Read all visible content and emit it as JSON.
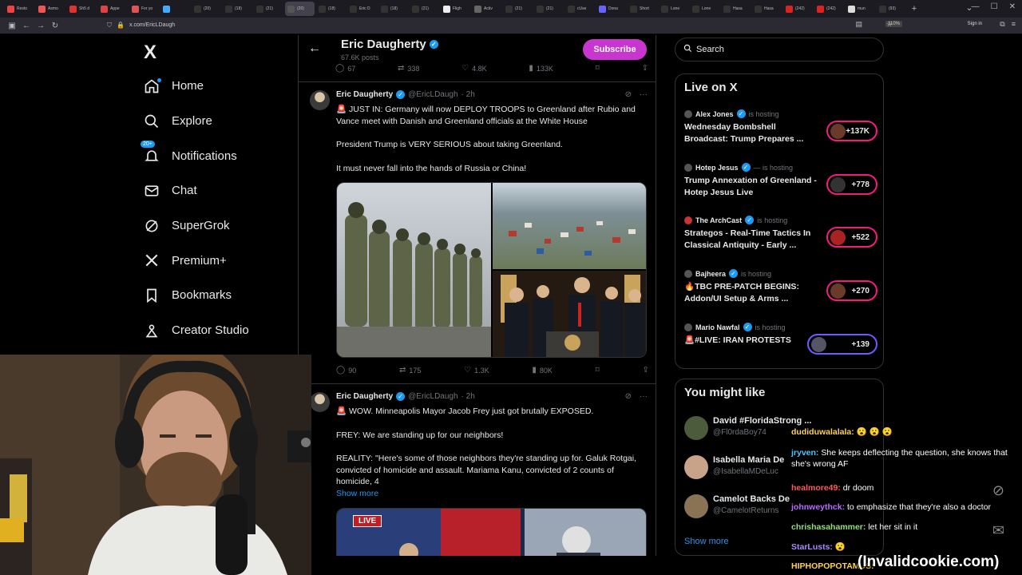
{
  "browser": {
    "tabs": [
      "Resto",
      "Asmo",
      "Sh5 d",
      "Appe",
      "For yo",
      "",
      "(20)",
      "(18)",
      "(21)",
      "(20)",
      "(18)",
      "Eric D",
      "(18)",
      "(21)",
      "Fligh",
      "Activ",
      "(21)",
      "(21)",
      "cUse",
      "Dona",
      "Short",
      "Lone",
      "Lone",
      "Hasa",
      "Hasa",
      "(242)",
      "(242)",
      "mun",
      "(93)"
    ],
    "active_tab_index": 9,
    "url": "x.com/EricLDaugh",
    "zoom": "110%",
    "signin": "Sign in",
    "new_tab": "+"
  },
  "sidebar": {
    "logo": "X",
    "items": [
      {
        "label": "Home",
        "icon": "home-icon"
      },
      {
        "label": "Explore",
        "icon": "search-icon"
      },
      {
        "label": "Notifications",
        "icon": "bell-icon",
        "badge": "20+"
      },
      {
        "label": "Chat",
        "icon": "mail-icon"
      },
      {
        "label": "SuperGrok",
        "icon": "grok-icon"
      },
      {
        "label": "Premium+",
        "icon": "x-premium-icon"
      },
      {
        "label": "Bookmarks",
        "icon": "bookmark-icon"
      },
      {
        "label": "Creator Studio",
        "icon": "creator-icon"
      }
    ]
  },
  "profile_header": {
    "name": "Eric Daugherty",
    "posts": "67.6K posts",
    "subscribe": "Subscribe",
    "prev_stats": {
      "replies": "67",
      "reposts": "338",
      "likes": "4.8K",
      "views": "133K"
    }
  },
  "tweets": [
    {
      "name": "Eric Daugherty",
      "handle": "@EricLDaugh",
      "time": "· 2h",
      "paragraphs": [
        "🚨 JUST IN: Germany will now DEPLOY TROOPS to Greenland after Rubio and Vance meet with Danish and Greenland officials at the White House",
        "President Trump is VERY SERIOUS about taking Greenland.",
        "It must never fall into the hands of Russia or China!"
      ],
      "stats": {
        "replies": "90",
        "reposts": "175",
        "likes": "1.3K",
        "views": "80K"
      }
    },
    {
      "name": "Eric Daugherty",
      "handle": "@EricLDaugh",
      "time": "· 2h",
      "paragraphs": [
        "🚨 WOW. Minneapolis Mayor Jacob Frey just got brutally EXPOSED.",
        "FREY: We are standing up for our neighbors!",
        "REALITY: \"Here's some of those neighbors they're standing up for. Galuk Rotgai, convicted of homicide and assault. Mariama Kanu, convicted of 2 counts of homicide, 4"
      ],
      "show_more": "Show more",
      "media_label": "LIVE"
    }
  ],
  "search": {
    "placeholder": "Search"
  },
  "live": {
    "title": "Live on X",
    "items": [
      {
        "host": "Alex Jones",
        "status": "is hosting",
        "title": "Wednesday Bombshell Broadcast: Trump Prepares ...",
        "count": "+137K"
      },
      {
        "host": "Hotep Jesus",
        "status": "— is hosting",
        "title": "Trump Annexation of Greenland - Hotep Jesus Live",
        "count": "+778"
      },
      {
        "host": "The ArchCast",
        "status": "is hosting",
        "title": "Strategos - Real-Time Tactics In Classical Antiquity - Early ...",
        "count": "+522"
      },
      {
        "host": "Bajheera",
        "status": "is hosting",
        "title": "🔥TBC PRE-PATCH BEGINS: Addon/UI Setup & Arms ...",
        "count": "+270"
      },
      {
        "host": "Mario Nawfal",
        "status": "is hosting",
        "title": "🚨#LIVE: IRAN PROTESTS",
        "count": "+139"
      }
    ]
  },
  "you_might_like": {
    "title": "You might like",
    "items": [
      {
        "name": "David #FloridaStrong ...",
        "handle": "@Fl0rdaBoy74"
      },
      {
        "name": "Isabella Maria De",
        "handle": "@IsabellaMDeLuc"
      },
      {
        "name": "Camelot Backs De",
        "handle": "@CamelotReturns"
      }
    ],
    "show_more": "Show more"
  },
  "chat": {
    "lines": [
      {
        "user": "dudiduwalalala:",
        "msg": "",
        "color": "#ffd24a"
      },
      {
        "user": "jryven:",
        "msg": "She keeps deflecting the question, she knows that she's wrong AF",
        "color": "#4ec4ff"
      },
      {
        "user": "healmore49:",
        "msg": "dr doom",
        "color": "#ff5a5a"
      },
      {
        "user": "johnweythck:",
        "msg": "to emphasize that they're also a doctor",
        "color": "#b86bff"
      },
      {
        "user": "chrishasahammer:",
        "msg": "let her sit in it",
        "color": "#8fe07a"
      },
      {
        "user": "StarLusts:",
        "msg": "",
        "color": "#a78bff"
      },
      {
        "user": "HIPHOPOPOTAMUS:",
        "msg": "",
        "color": "#ffd24a"
      }
    ],
    "watermark": "(Invalidcookie.com)"
  }
}
